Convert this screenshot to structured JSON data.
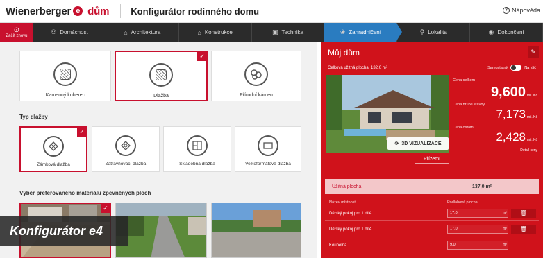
{
  "header": {
    "logo_text": "Wienerberger",
    "logo_e": "e",
    "logo_suffix": "dům",
    "title": "Konfigurátor rodinného domu",
    "help_label": "Nápověda"
  },
  "nav": {
    "home_label": "Začít znovu",
    "items": [
      {
        "label": "Domácnost",
        "icon": "family-icon"
      },
      {
        "label": "Architektura",
        "icon": "house-plan-icon"
      },
      {
        "label": "Konstrukce",
        "icon": "construction-icon"
      },
      {
        "label": "Technika",
        "icon": "tech-icon"
      },
      {
        "label": "Zahradničení",
        "icon": "garden-icon",
        "active": true
      },
      {
        "label": "Lokalita",
        "icon": "location-icon"
      },
      {
        "label": "Dokončení",
        "icon": "finish-icon"
      }
    ]
  },
  "surface_options": [
    {
      "label": "Kamenný koberec",
      "selected": false
    },
    {
      "label": "Dlažba",
      "selected": true
    },
    {
      "label": "Přírodní kámen",
      "selected": false
    }
  ],
  "paving_type": {
    "title": "Typ dlažby",
    "options": [
      {
        "label": "Zámková dlažba",
        "selected": true
      },
      {
        "label": "Zatravňovací dlažba",
        "selected": false
      },
      {
        "label": "Skladebná dlažba",
        "selected": false
      },
      {
        "label": "Velkoformátová dlažba",
        "selected": false
      }
    ]
  },
  "material": {
    "title": "Výběr preferovaného materiálu zpevněných ploch"
  },
  "overlay_caption": "Konfigurátor e4",
  "my_house": {
    "title": "Můj dům",
    "area_text": "Celková užitná plocha: 132,0 m²",
    "toggle_left": "Samostatný",
    "toggle_right": "Na klíč",
    "visualization_button": "3D VIZUALIZACE",
    "price_total_label": "Cena celkem",
    "price_total": "9,600",
    "price_total_unit": "mil. Kč",
    "price_house_label": "Cena hrubé stavby",
    "price_house": "7,173",
    "price_house_unit": "mil. Kč",
    "price_other_label": "Cena ostatní",
    "price_other": "2,428",
    "price_other_unit": "mil. Kč",
    "detail_link": "Detail ceny",
    "subtitle": "Přízemí",
    "useful_area_label": "Užitná plocha",
    "useful_area_value": "137,0 m²",
    "col_room": "Název místnosti",
    "col_area": "Podlahová plocha",
    "rooms": [
      {
        "name": "Dětský pokoj pro 1 dítě",
        "value": "17,0",
        "unit": "m²"
      },
      {
        "name": "Dětský pokoj pro 1 dítě",
        "value": "17,0",
        "unit": "m²"
      },
      {
        "name": "Koupelna",
        "value": "9,0",
        "unit": "m²"
      }
    ]
  },
  "colors": {
    "brand_red": "#c8102e",
    "panel_red": "#d0121b",
    "nav_dark": "#2b2b2b",
    "nav_active": "#2a7cc0"
  }
}
